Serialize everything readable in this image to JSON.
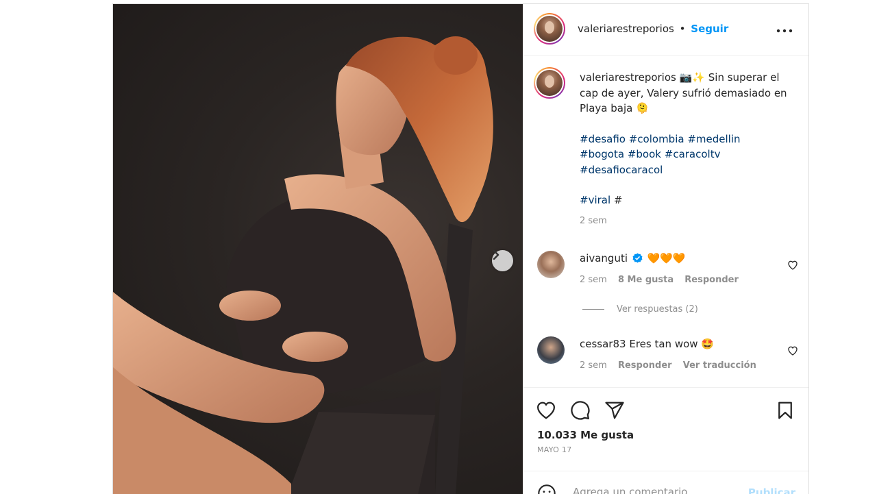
{
  "post": {
    "username": "valeriarestreporios",
    "separator": "•",
    "follow_label": "Seguir",
    "more_label": "•••"
  },
  "caption": {
    "username": "valeriarestreporios",
    "emoji": "📷✨",
    "text": "Sin superar el cap de ayer, Valery sufrió demasiado en Playa baja 🫠",
    "hashtags_1": [
      "#desafio",
      "#colombia",
      "#medellin",
      "#bogota",
      "#book",
      "#caracoltv",
      "#desafiocaracol"
    ],
    "hashtag_viral": "#viral",
    "hashtag_tail": "#",
    "time": "2 sem"
  },
  "comments": [
    {
      "username": "aivanguti",
      "verified": true,
      "text": "🧡🧡🧡",
      "time": "2 sem",
      "likes": "8 Me gusta",
      "reply": "Responder",
      "view_replies": "Ver respuestas (2)"
    },
    {
      "username": "cessar83",
      "text": "Eres tan wow 🤩",
      "time": "2 sem",
      "reply": "Responder",
      "translate": "Ver traducción"
    }
  ],
  "actions": {
    "likes": "10.033 Me gusta",
    "date": "MAYO 17"
  },
  "add_comment": {
    "placeholder": "Agrega un comentario...",
    "publish": "Publicar"
  },
  "icons": {
    "like": "heart-icon",
    "comment": "comment-icon",
    "share": "paper-plane-icon",
    "save": "bookmark-icon",
    "next": "chevron-right-icon",
    "emoji": "smiley-icon",
    "verified": "verified-badge-icon"
  },
  "colors": {
    "link_blue": "#0095f6",
    "hashtag": "#00376b",
    "muted": "#8e8e8e",
    "verified": "#0095f6"
  }
}
